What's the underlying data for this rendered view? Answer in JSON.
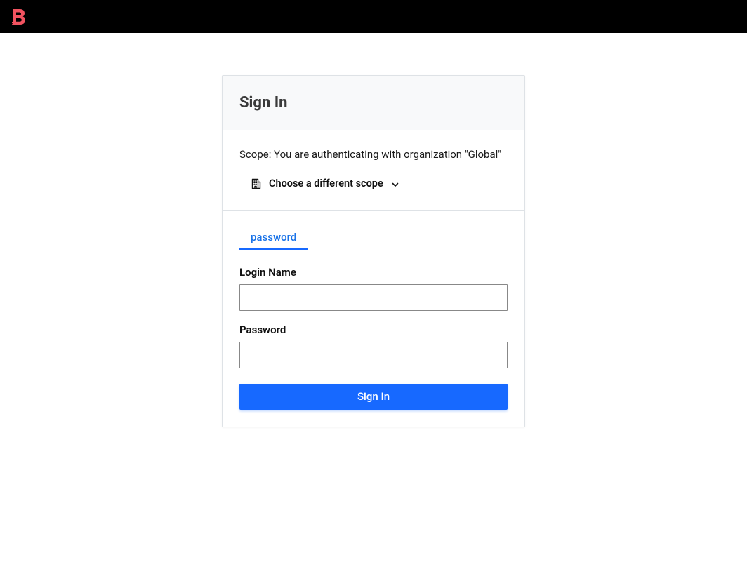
{
  "header": {
    "logo_name": "boundary-logo"
  },
  "signin": {
    "title": "Sign In",
    "scope_text": "Scope: You are authenticating with organization \"Global\"",
    "choose_scope_label": "Choose a different scope",
    "tabs": [
      {
        "id": "password",
        "label": "password",
        "active": true
      }
    ],
    "fields": {
      "login_name": {
        "label": "Login Name",
        "value": ""
      },
      "password": {
        "label": "Password",
        "value": ""
      }
    },
    "submit_label": "Sign In"
  },
  "colors": {
    "accent": "#1769ff",
    "logo": "#f25360",
    "header_bg": "#000000"
  }
}
